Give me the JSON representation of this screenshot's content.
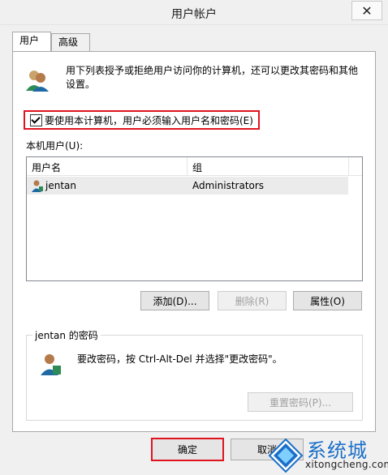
{
  "window": {
    "title": "用户帐户",
    "close_glyph": "✕"
  },
  "tabs": [
    {
      "label": "用户",
      "active": true
    },
    {
      "label": "高级",
      "active": false
    }
  ],
  "intro": {
    "icon": "users-icon",
    "text": "用下列表授予或拒绝用户访问你的计算机，还可以更改其密码和其他设置。"
  },
  "require_login_checkbox": {
    "checked": true,
    "label": "要使用本计算机，用户必须输入用户名和密码(E)"
  },
  "local_users": {
    "label": "本机用户(U):",
    "columns": [
      "用户名",
      "组"
    ],
    "rows": [
      {
        "user": "jentan",
        "group": "Administrators",
        "icon": "user-icon",
        "selected": true
      }
    ]
  },
  "buttons": {
    "add": "添加(D)...",
    "delete": "删除(R)",
    "properties": "属性(O)",
    "ok": "确定",
    "cancel": "取消"
  },
  "password_group": {
    "title": "jentan 的密码",
    "icon": "user-key-icon",
    "text": "要改密码，按 Ctrl-Alt-Del 并选择\"更改密码\"。",
    "reset_button": "重置密码(P)..."
  },
  "watermark": {
    "text": "系统城",
    "subtext": "xitongcheng.com",
    "icon": "windows-logo-icon"
  },
  "colors": {
    "highlight_border": "#e0141e",
    "selection_bg": "#ebebeb",
    "brand_blue": "#1b6fc8"
  }
}
